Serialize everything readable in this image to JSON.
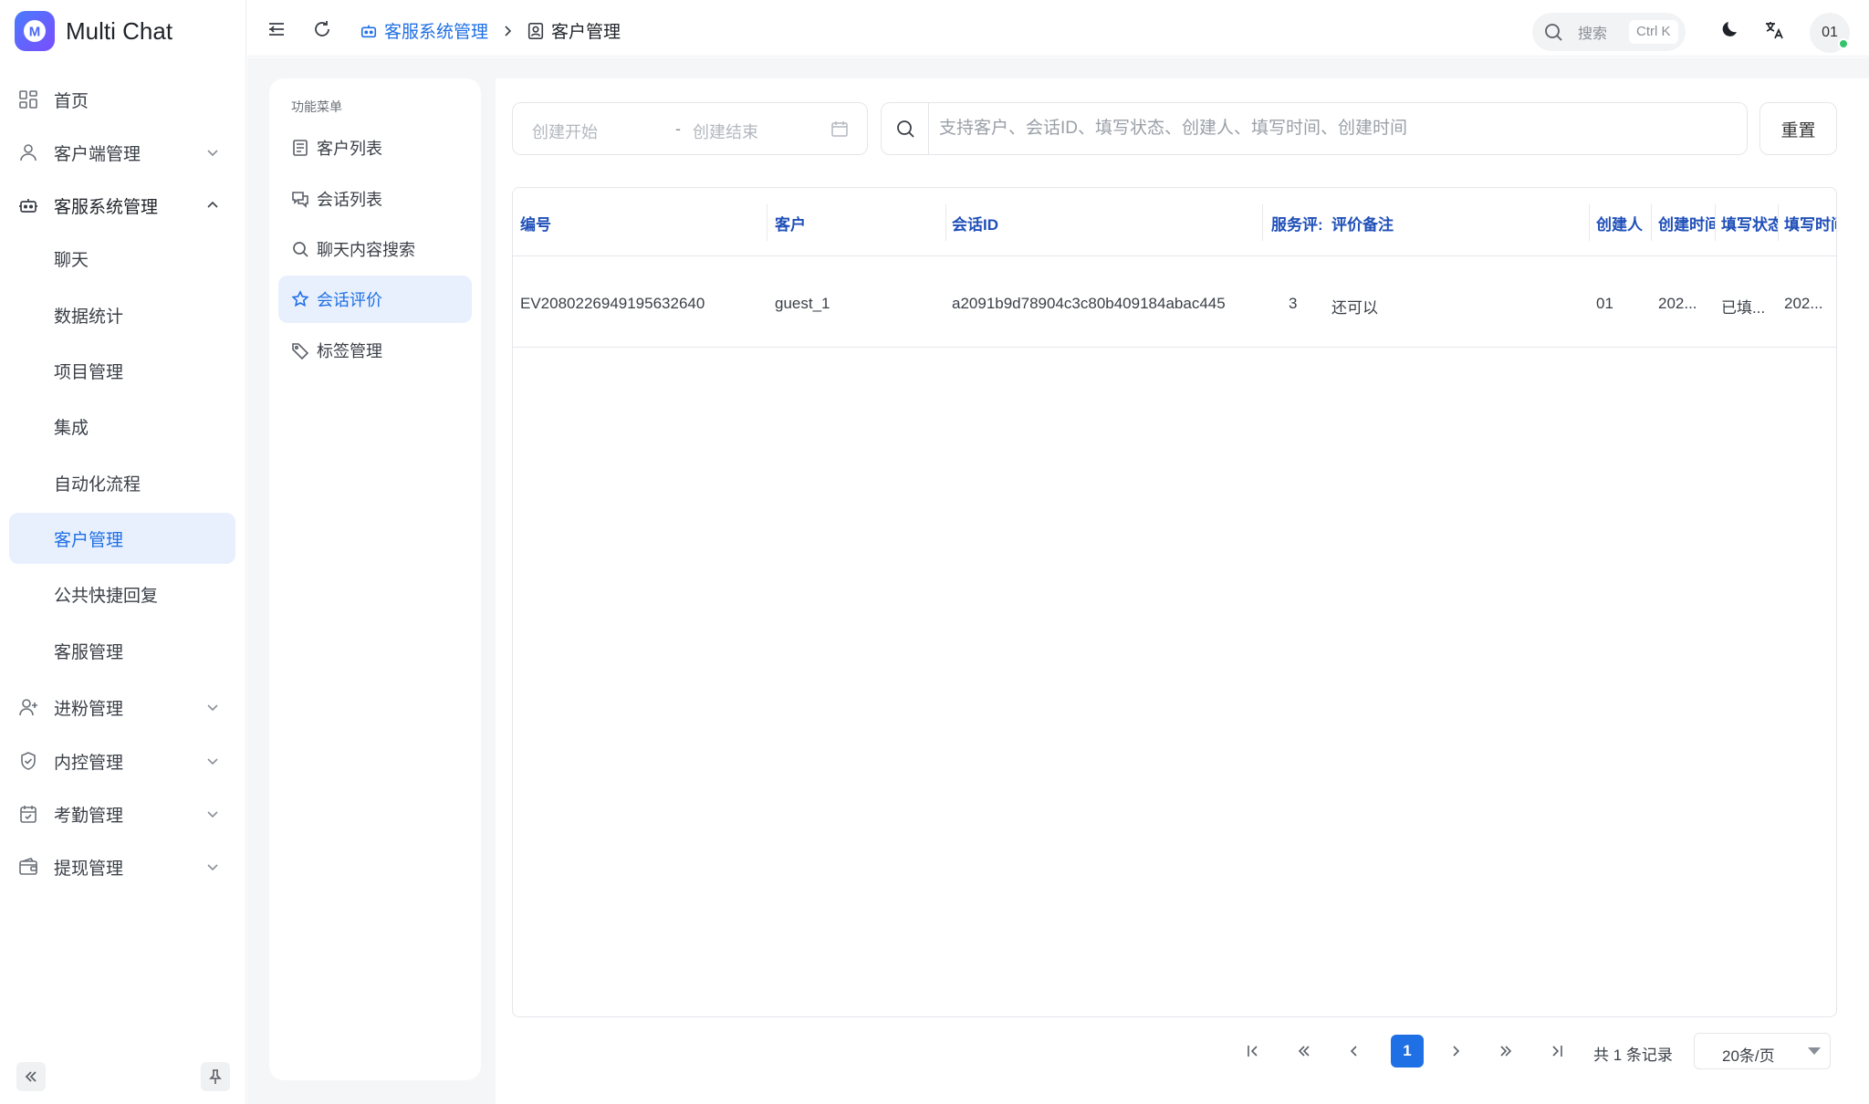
{
  "app": {
    "name": "Multi Chat"
  },
  "sidebar": {
    "items": [
      {
        "label": "首页",
        "icon": "grid-icon"
      },
      {
        "label": "客户端管理",
        "icon": "user-icon",
        "expandable": true
      },
      {
        "label": "客服系统管理",
        "icon": "robot-icon",
        "expanded": true
      },
      {
        "label": "聊天"
      },
      {
        "label": "数据统计"
      },
      {
        "label": "项目管理"
      },
      {
        "label": "集成"
      },
      {
        "label": "自动化流程"
      },
      {
        "label": "客户管理",
        "active": true
      },
      {
        "label": "公共快捷回复"
      },
      {
        "label": "客服管理"
      },
      {
        "label": "进粉管理",
        "icon": "user-plus-icon",
        "expandable": true
      },
      {
        "label": "内控管理",
        "icon": "shield-icon",
        "expandable": true
      },
      {
        "label": "考勤管理",
        "icon": "calendar-check-icon",
        "expandable": true
      },
      {
        "label": "提现管理",
        "icon": "wallet-icon",
        "expandable": true
      }
    ]
  },
  "topbar": {
    "breadcrumb": [
      {
        "label": "客服系统管理",
        "icon": "robot-icon"
      },
      {
        "label": "客户管理",
        "icon": "contact-icon"
      }
    ],
    "search_label": "搜索",
    "search_shortcut": "Ctrl K",
    "user_initials": "01"
  },
  "func_menu": {
    "title": "功能菜单",
    "items": [
      {
        "label": "客户列表",
        "icon": "document-icon"
      },
      {
        "label": "会话列表",
        "icon": "chat-icon"
      },
      {
        "label": "聊天内容搜索",
        "icon": "search-icon"
      },
      {
        "label": "会话评价",
        "icon": "star-icon",
        "active": true
      },
      {
        "label": "标签管理",
        "icon": "tag-icon"
      }
    ]
  },
  "filters": {
    "date_start_placeholder": "创建开始",
    "date_separator": "-",
    "date_end_placeholder": "创建结束",
    "search_placeholder": "支持客户、会话ID、填写状态、创建人、填写时间、创建时间",
    "reset_label": "重置"
  },
  "table": {
    "columns": [
      "编号",
      "客户",
      "会话ID",
      "服务评:",
      "评价备注",
      "创建人",
      "创建时间",
      "填写状态",
      "填写时间"
    ],
    "rows": [
      [
        "EV2080226949195632640",
        "guest_1",
        "a2091b9d78904c3c80b409184abac445",
        "3",
        "还可以",
        "01",
        "202...",
        "已填...",
        "202..."
      ]
    ]
  },
  "pagination": {
    "current_page": "1",
    "total_text": "共 1 条记录",
    "page_size": "20条/页"
  },
  "colors": {
    "accent": "#1f6fe5",
    "active_bg": "#e8f0fd",
    "header_text": "#1f4fb8"
  }
}
